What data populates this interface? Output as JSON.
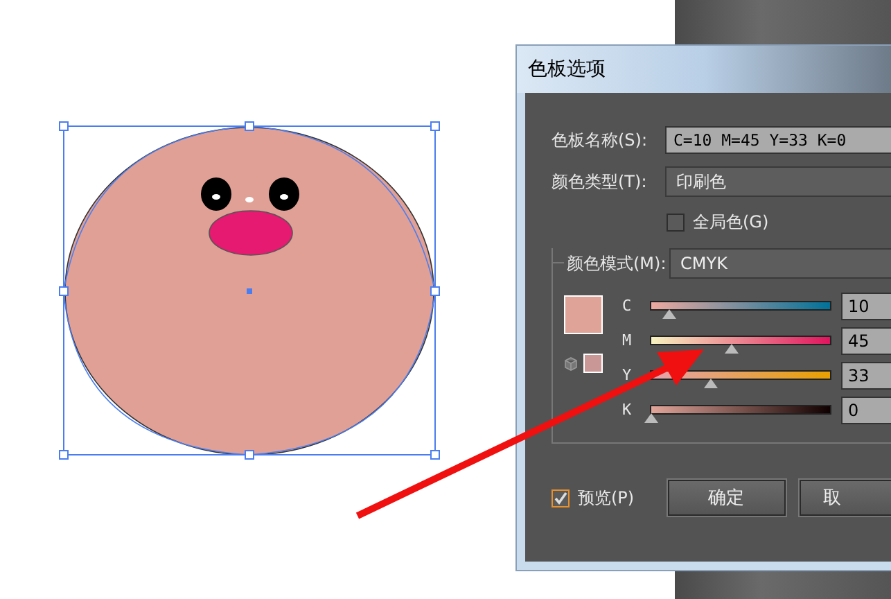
{
  "dialog": {
    "title": "色板选项",
    "swatch_name": {
      "label": "色板名称(S):",
      "value": "C=10 M=45 Y=33 K=0"
    },
    "color_type": {
      "label": "颜色类型(T):",
      "value": "印刷色"
    },
    "global_color": {
      "label": "全局色(G)",
      "checked": false
    },
    "color_mode": {
      "label": "颜色模式(M):",
      "value": "CMYK"
    },
    "channels": [
      {
        "label": "C",
        "level": 0.1,
        "value": "10"
      },
      {
        "label": "M",
        "level": 0.45,
        "value": "45"
      },
      {
        "label": "Y",
        "level": 0.33,
        "value": "33"
      },
      {
        "label": "K",
        "level": 0,
        "value": "0"
      }
    ],
    "preview": {
      "label": "预览(P)",
      "checked": true
    },
    "buttons": [
      "确定",
      "取"
    ]
  }
}
